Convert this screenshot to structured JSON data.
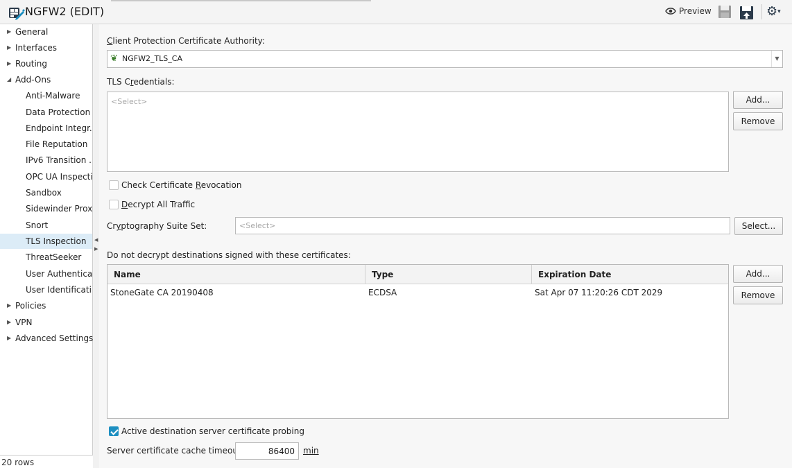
{
  "window": {
    "title": "NGFW2 (EDIT)",
    "preview_label": "Preview"
  },
  "icons": {
    "app": "firewall-edit-icon",
    "preview": "eye-icon",
    "save": "save-icon",
    "save_install": "save-and-install-icon",
    "tools": "gear-icon"
  },
  "sidebar": {
    "items": [
      {
        "label": "General",
        "expanded": false
      },
      {
        "label": "Interfaces",
        "expanded": false
      },
      {
        "label": "Routing",
        "expanded": false
      },
      {
        "label": "Add-Ons",
        "expanded": true
      },
      {
        "label": "Anti-Malware"
      },
      {
        "label": "Data Protection"
      },
      {
        "label": "Endpoint Integr..."
      },
      {
        "label": "File Reputation"
      },
      {
        "label": "IPv6 Transition ..."
      },
      {
        "label": "OPC UA Inspecti..."
      },
      {
        "label": "Sandbox"
      },
      {
        "label": "Sidewinder Proxy"
      },
      {
        "label": "Snort"
      },
      {
        "label": "TLS Inspection",
        "selected": true
      },
      {
        "label": "ThreatSeeker"
      },
      {
        "label": "User Authentica..."
      },
      {
        "label": "User Identificati..."
      },
      {
        "label": "Policies",
        "expanded": false
      },
      {
        "label": "VPN",
        "expanded": false
      },
      {
        "label": "Advanced Settings",
        "expanded": false
      }
    ],
    "row_count": "20 rows"
  },
  "main": {
    "client_ca": {
      "pre": "",
      "mnemonic": "C",
      "post": "lient Protection Certificate Authority:",
      "value": "NGFW2_TLS_CA"
    },
    "tls_credentials": {
      "pre": "TLS C",
      "mnemonic": "r",
      "post": "edentials:",
      "placeholder": "<Select>",
      "add_label": "Add...",
      "remove_label": "Remove"
    },
    "check_revocation": {
      "pre": "Check Certificate ",
      "mnemonic": "R",
      "post": "evocation",
      "checked": false
    },
    "decrypt_all": {
      "pre": "",
      "mnemonic": "D",
      "post": "ecrypt All Traffic",
      "checked": false
    },
    "crypto_suite": {
      "pre": "Cr",
      "mnemonic": "y",
      "post": "ptography Suite Set:",
      "placeholder": "<Select>",
      "select_label": "Select..."
    },
    "no_decrypt": {
      "label": "Do not decrypt destinations signed with these certificates:",
      "columns": [
        "Name",
        "Type",
        "Expiration Date"
      ],
      "rows": [
        {
          "name": "StoneGate CA 20190408",
          "type": "ECDSA",
          "expiration": "Sat Apr 07 11:20:26 CDT 2029"
        }
      ],
      "add_label": "Add...",
      "remove_label": "Remove"
    },
    "probing": {
      "label": "Active destination server certificate probing",
      "checked": true
    },
    "cache_timeout": {
      "label": "Server certificate cache timeout:",
      "value": "86400",
      "unit": "min"
    }
  },
  "colors": {
    "selected_row": "#dcecf7",
    "checkbox_accent": "#1d8fc1"
  }
}
